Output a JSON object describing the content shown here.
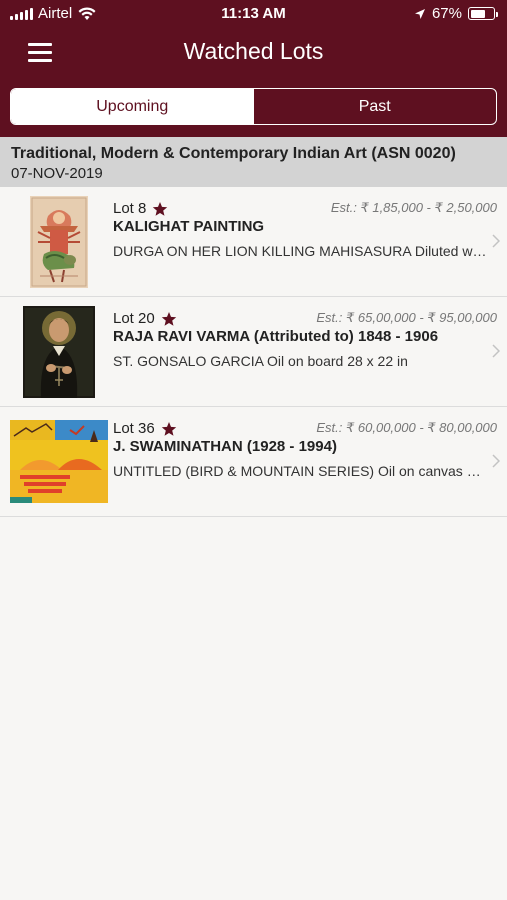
{
  "status_bar": {
    "carrier": "Airtel",
    "time": "11:13 AM",
    "battery": "67%",
    "battery_level": 0.67,
    "icons": [
      "signal-icon",
      "wifi-icon",
      "location-icon",
      "battery-icon"
    ]
  },
  "header": {
    "title": "Watched Lots",
    "menu_icon": "hamburger-menu-icon"
  },
  "tabs": [
    {
      "label": "Upcoming",
      "active": true
    },
    {
      "label": "Past",
      "active": false
    }
  ],
  "auction": {
    "title": "Traditional, Modern & Contemporary Indian Art (ASN 0020)",
    "date": "07-NOV-2019"
  },
  "lots": [
    {
      "lot": "Lot 8",
      "estimate": "Est.: ₹ 1,85,000 - ₹ 2,50,000",
      "artist": "KALIGHAT PAINTING",
      "description": "DURGA ON HER LION KILLING MAHISASURA Diluted watercolour on paper"
    },
    {
      "lot": "Lot 20",
      "estimate": "Est.: ₹ 65,00,000 - ₹ 95,00,000",
      "artist": "RAJA RAVI VARMA (Attributed to) 1848 - 1906",
      "description": "ST. GONSALO GARCIA Oil on board 28 x 22 in"
    },
    {
      "lot": "Lot 36",
      "estimate": "Est.: ₹ 60,00,000 - ₹ 80,00,000",
      "artist": "J. SWAMINATHAN (1928 - 1994)",
      "description": "UNTITLED (BIRD & MOUNTAIN SERIES) Oil on canvas Signed"
    }
  ],
  "colors": {
    "brand": "#5e1020",
    "section_bg": "#d3d3d3",
    "page_bg": "#f7f6f4",
    "star": "#5e1020"
  }
}
